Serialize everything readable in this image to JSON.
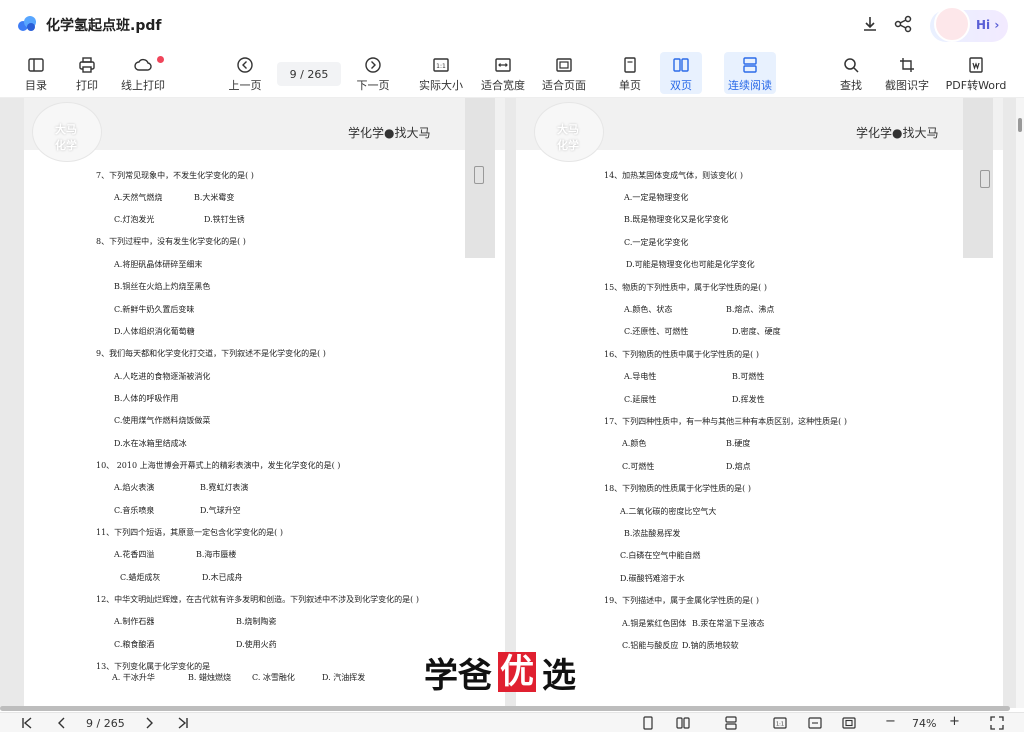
{
  "app": {
    "title": "化学氢起点班.pdf",
    "hi_label": "Hi",
    "hi_chevron": "›"
  },
  "toolbar": {
    "outline": "目录",
    "print": "打印",
    "online_print": "线上打印",
    "prev_page": "上一页",
    "page_indicator": "9  / 265",
    "next_page": "下一页",
    "actual_size": "实际大小",
    "fit_width": "适合宽度",
    "fit_page": "适合页面",
    "single_page": "单页",
    "double_page": "双页",
    "continuous": "连续阅读",
    "find": "查找",
    "ocr": "截图识字",
    "pdf_to_word": "PDF转Word"
  },
  "icons": {
    "app_logo": "cloud-logo-icon",
    "download": "download-icon",
    "share": "share-icon",
    "outline": "outline-icon",
    "print": "printer-icon",
    "online_print": "cloud-print-icon",
    "prev": "circle-left-icon",
    "next": "circle-right-icon",
    "actual_size": "one-to-one-icon",
    "fit_width": "fit-width-icon",
    "fit_page": "fit-page-icon",
    "single_page": "single-page-icon",
    "double_page": "double-page-icon",
    "continuous": "continuous-icon",
    "find": "search-icon",
    "ocr": "crop-icon",
    "pdf_to_word": "word-convert-icon"
  },
  "colors": {
    "accent": "#2a6ae8",
    "active_bg": "#e8f1fe",
    "badge": "#f0455a",
    "watermark_red": "#e02030"
  },
  "left_page": {
    "brand": "学化学●找大马",
    "logo_line1": "大马",
    "logo_line2": "化学",
    "questions": [
      {
        "text": "7、下列常见现象中，不发生化学变化的是(    )"
      },
      {
        "text": "A.天然气燃烧"
      },
      {
        "text": "B.大米霉变"
      },
      {
        "text": "C.灯泡发光"
      },
      {
        "text": "D.铁钉生锈"
      },
      {
        "text": "8、下列过程中，没有发生化学变化的是(    )"
      },
      {
        "text": "A.将胆矾晶体研碎至细末"
      },
      {
        "text": "B.铜丝在火焰上灼烧至黑色"
      },
      {
        "text": "C.新鲜牛奶久置后变味"
      },
      {
        "text": "D.人体组织消化葡萄糖"
      },
      {
        "text": "9、我们每天都和化学变化打交道，下列叙述不是化学变化的是(    )"
      },
      {
        "text": "A.人吃进的食物逐渐被消化"
      },
      {
        "text": "B.人体的呼吸作用"
      },
      {
        "text": "C.使用煤气作燃料烧饭做菜"
      },
      {
        "text": "D.水在冰箱里结成冰"
      },
      {
        "text": "10、  2010 上海世博会开幕式上的精彩表演中，发生化学变化的是(    )"
      },
      {
        "text": "A.焰火表演"
      },
      {
        "text": "B.霓虹灯表演"
      },
      {
        "text": "C.音乐喷泉"
      },
      {
        "text": "D.气球升空"
      },
      {
        "text": "11、下列四个短语，其原意一定包含化学变化的是(    )"
      },
      {
        "text": "A.花香四溢"
      },
      {
        "text": "B.海市蜃楼"
      },
      {
        "text": "C.蜡炬成灰"
      },
      {
        "text": "D.木已成舟"
      },
      {
        "text": "12、中华文明灿烂辉煌，在古代就有许多发明和创造。下列叙述中不涉及到化学变化的是(    )"
      },
      {
        "text": "A.制作石器"
      },
      {
        "text": "B.烧制陶瓷"
      },
      {
        "text": "C.粮食酿酒"
      },
      {
        "text": "D.使用火药"
      },
      {
        "text": "13、下列变化属于化学变化的是"
      },
      {
        "text": "A.  干冰升华"
      },
      {
        "text": "B.  蜡烛燃烧"
      },
      {
        "text": "C.  冰雪融化"
      },
      {
        "text": "D.  汽油挥发"
      }
    ]
  },
  "right_page": {
    "brand": "学化学●找大马",
    "logo_line1": "大马",
    "logo_line2": "化学",
    "questions": [
      {
        "text": "14、加热某固体变成气体，则该变化(    )"
      },
      {
        "text": "A.一定是物理变化"
      },
      {
        "text": "B.既是物理变化又是化学变化"
      },
      {
        "text": "C.一定是化学变化"
      },
      {
        "text": "D.可能是物理变化也可能是化学变化"
      },
      {
        "text": "15、物质的下列性质中，属于化学性质的是(    )"
      },
      {
        "text": "A.颜色、状态"
      },
      {
        "text": "B.熔点、沸点"
      },
      {
        "text": "C.还原性、可燃性"
      },
      {
        "text": "D.密度、硬度"
      },
      {
        "text": "16、下列物质的性质中属于化学性质的是(    )"
      },
      {
        "text": "A.导电性"
      },
      {
        "text": "B.可燃性"
      },
      {
        "text": "C.延展性"
      },
      {
        "text": "D.挥发性"
      },
      {
        "text": "17、下列四种性质中，有一种与其他三种有本质区别，这种性质是(    )"
      },
      {
        "text": "A.颜色"
      },
      {
        "text": "B.硬度"
      },
      {
        "text": "C.可燃性"
      },
      {
        "text": "D.熔点"
      },
      {
        "text": "18、下列物质的性质属于化学性质的是(    )"
      },
      {
        "text": "A.二氧化碳的密度比空气大"
      },
      {
        "text": "B.浓盐酸易挥发"
      },
      {
        "text": "C.白磷在空气中能自燃"
      },
      {
        "text": "D.碳酸钙难溶于水"
      },
      {
        "text": "19、下列描述中，属于金属化学性质的是(        )"
      },
      {
        "text": "A.铜是紫红色固体"
      },
      {
        "text": "B.汞在常温下呈液态"
      },
      {
        "text": "C.铝能与酸反应"
      },
      {
        "text": "D.钠的质地较软"
      }
    ]
  },
  "watermark": {
    "part1": "学爸",
    "part2": "优",
    "part3": "选"
  },
  "statusbar": {
    "page_indicator": "9  / 265",
    "zoom": "74%",
    "zoom_minus": "−",
    "zoom_plus": "+"
  }
}
